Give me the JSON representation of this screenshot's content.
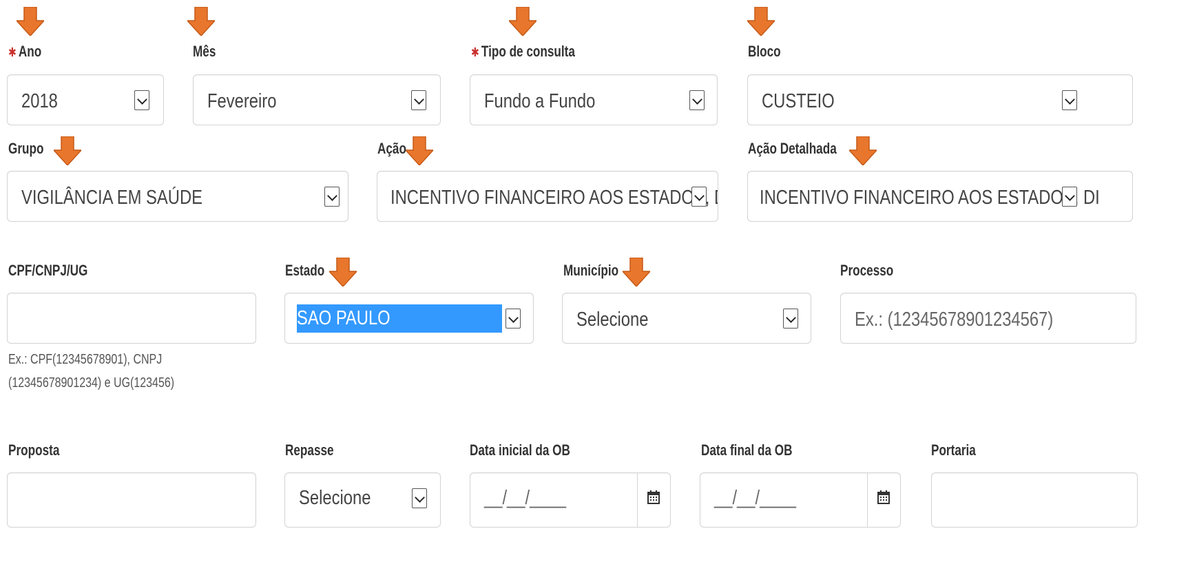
{
  "labels": {
    "ano": "Ano",
    "mes": "Mês",
    "tipo": "Tipo de consulta",
    "bloco": "Bloco",
    "grupo": "Grupo",
    "acao": "Ação",
    "acao_detalhada": "Ação Detalhada",
    "cpf": "CPF/CNPJ/UG",
    "estado": "Estado",
    "municipio": "Município",
    "processo": "Processo",
    "proposta": "Proposta",
    "repasse": "Repasse",
    "data_inicial": "Data inicial da OB",
    "data_final": "Data final da OB",
    "portaria": "Portaria"
  },
  "required_marker": "✱",
  "fields": {
    "ano": "2018",
    "mes": "Fevereiro",
    "tipo": "Fundo a Fundo",
    "bloco": "CUSTEIO",
    "grupo": "VIGILÂNCIA EM SAÚDE",
    "acao": "INCENTIVO FINANCEIRO AOS ESTADOS, DI",
    "acao_detalhada": "INCENTIVO FINANCEIRO AOS ESTADOS, DI",
    "cpf": "",
    "estado": "SAO PAULO",
    "municipio": "Selecione",
    "processo_placeholder": "Ex.: (12345678901234567)",
    "proposta": "",
    "repasse": "Selecione",
    "data_inicial_mask": "__/__/____",
    "data_final_mask": "__/__/____",
    "portaria": ""
  },
  "help": {
    "cpf_line1": "Ex.: CPF(12345678901), CNPJ",
    "cpf_line2": "(12345678901234) e UG(123456)"
  },
  "icons": {
    "arrow": "down-arrow-icon",
    "dropdown": "chevron-down-icon",
    "calendar": "calendar-icon"
  },
  "colors": {
    "arrow": "#e8762d",
    "required": "#c9302c",
    "selection": "#3399ff"
  }
}
